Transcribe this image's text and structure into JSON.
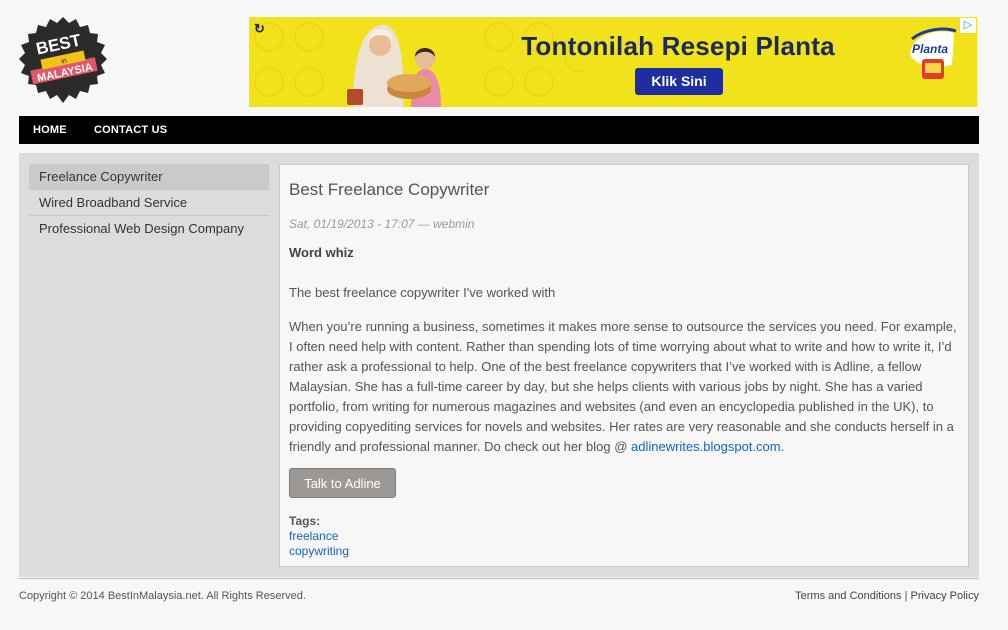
{
  "logo": {
    "line1": "BEST",
    "line2": "in",
    "line3": "MALAYSIA"
  },
  "ad": {
    "headline": "Tontonilah Resepi Planta",
    "cta": "Klik Sini",
    "brand": "Planta",
    "refresh_icon": "refresh-icon",
    "adchoices_icon": "adchoices-icon",
    "background_color": "#f2e21c",
    "cta_color": "#1d2f9e"
  },
  "nav": {
    "items": [
      "HOME",
      "CONTACT US"
    ]
  },
  "sidebar": {
    "items": [
      {
        "label": "Freelance Copywriter",
        "active": true
      },
      {
        "label": "Wired Broadband Service",
        "active": false
      },
      {
        "label": "Professional Web Design Company",
        "active": false
      }
    ]
  },
  "post": {
    "title": "Best Freelance Copywriter",
    "meta": "Sat, 01/19/2013 - 17:07 — webmin",
    "subhead": "Word whiz",
    "lead": "The best freelance copywriter I've worked with",
    "body": "When you’re running a business, sometimes it makes more sense to outsource the services you need. For example, I often need help with content. Rather than spending lots of time worrying about what to write and how to write it, I’d rather ask a professional to help. One of the best freelance copywriters that I’ve worked with is Adline, a fellow Malaysian. She has a full-time career by day, but she helps clients with various jobs by night. She has a varied portfolio, from writing for numerous magazines and websites (and even an encyclopedia published in the UK), to providing copyediting services for novels and websites.  Her rates are very reasonable and she conducts herself in a friendly and professional manner. Do check out her blog @ ",
    "blog_link": "adlinewrites.blogspot.com",
    "body_end": ".",
    "button": "Talk to Adline",
    "tags_label": "Tags:",
    "tags": [
      "freelance",
      "copywriting"
    ]
  },
  "footer": {
    "copyright": "Copyright © 2014 BestInMalaysia.net. All Rights Reserved.",
    "terms": "Terms and Conditions",
    "separator": "|",
    "privacy": "Privacy Policy"
  },
  "colors": {
    "nav_bg": "#000000",
    "link": "#1a62c4",
    "container_bg": "#dcdcdc"
  }
}
